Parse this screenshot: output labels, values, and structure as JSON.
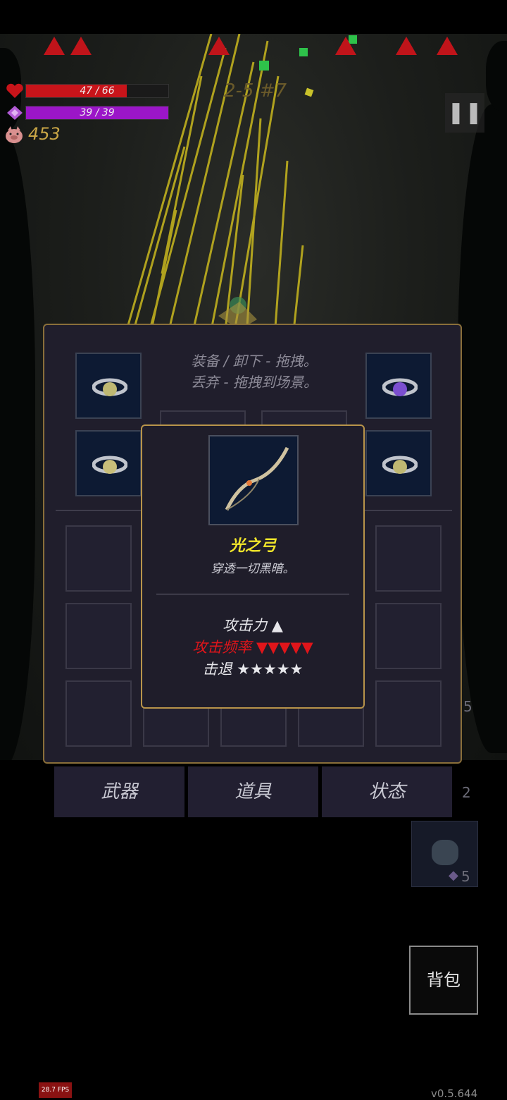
{
  "hud": {
    "hp_text": "47 / 66",
    "hp_fraction": 0.71,
    "mp_text": "39 / 39",
    "mp_fraction": 1.0,
    "gold": "453",
    "level": "2-5 #7",
    "pause_icon": "pause-icon"
  },
  "inventory": {
    "hint_line1": "装备 / 卸下 - 拖拽。",
    "hint_line2": "丢弃 - 拖拽到场景。",
    "tabs": [
      "武器",
      "道具",
      "状态"
    ]
  },
  "tooltip": {
    "name": "光之弓",
    "description": "穿透一切黑暗。",
    "stat_attack": "攻击力 ▲",
    "stat_rate": "攻击频率 ▼▼▼▼▼",
    "stat_knockback": "击退 ★★★★★"
  },
  "side_items": {
    "count_a": "5",
    "count_b": "2",
    "count_c": "5"
  },
  "backpack_label": "背包",
  "fps": "28.7 FPS",
  "version": "v0.5.644",
  "colors": {
    "hp": "#c8141a",
    "mp": "#9b16c8",
    "gold_text": "#c9a646",
    "level_text": "#6a5a2a",
    "item_name": "#f2e62a",
    "rate_red": "#e0151a",
    "panel_border": "#8a6f3a",
    "tooltip_border": "#b8944a"
  }
}
